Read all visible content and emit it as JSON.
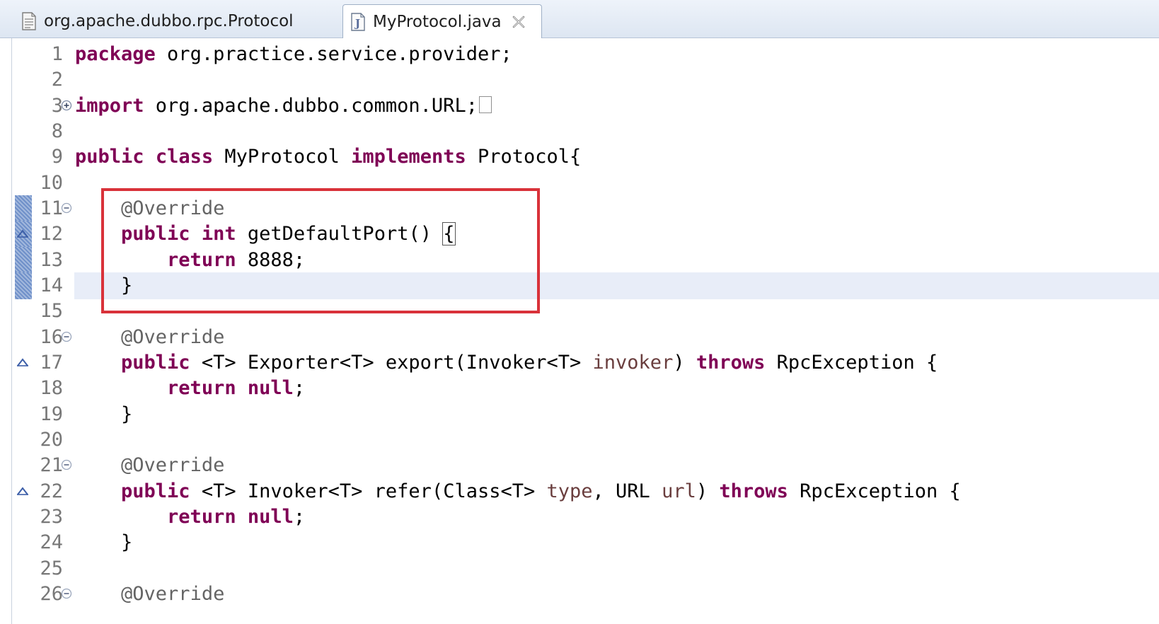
{
  "tabs": [
    {
      "label": "org.apache.dubbo.rpc.Protocol",
      "active": false
    },
    {
      "label": "MyProtocol.java",
      "active": true,
      "close_glyph": "✕"
    }
  ],
  "editor": {
    "lines": [
      {
        "num": "1",
        "tokens": [
          [
            "kw",
            "package"
          ],
          [
            "t",
            " org.practice.service.provider;"
          ]
        ]
      },
      {
        "num": "2",
        "tokens": []
      },
      {
        "num": "3",
        "fold": "expand",
        "tokens": [
          [
            "kw",
            "import"
          ],
          [
            "t",
            " org.apache.dubbo.common.URL;"
          ]
        ],
        "collapsed": true
      },
      {
        "num": "8",
        "tokens": []
      },
      {
        "num": "9",
        "tokens": [
          [
            "kw",
            "public"
          ],
          [
            "t",
            " "
          ],
          [
            "kw",
            "class"
          ],
          [
            "t",
            " MyProtocol "
          ],
          [
            "kw",
            "implements"
          ],
          [
            "t",
            " Protocol{"
          ]
        ]
      },
      {
        "num": "10",
        "tokens": []
      },
      {
        "num": "11",
        "fold": "collapse",
        "changed": true,
        "tokens": [
          [
            "t",
            "    "
          ],
          [
            "ann",
            "@Override"
          ]
        ]
      },
      {
        "num": "12",
        "changed": true,
        "override": true,
        "tokens": [
          [
            "t",
            "    "
          ],
          [
            "kw",
            "public"
          ],
          [
            "t",
            " "
          ],
          [
            "kw",
            "int"
          ],
          [
            "t",
            " getDefaultPort() "
          ],
          [
            "br",
            "{"
          ]
        ]
      },
      {
        "num": "13",
        "changed": true,
        "tokens": [
          [
            "t",
            "        "
          ],
          [
            "kw",
            "return"
          ],
          [
            "t",
            " 8888;"
          ]
        ]
      },
      {
        "num": "14",
        "changed": true,
        "current": true,
        "tokens": [
          [
            "t",
            "    }"
          ]
        ]
      },
      {
        "num": "15",
        "tokens": []
      },
      {
        "num": "16",
        "fold": "collapse",
        "tokens": [
          [
            "t",
            "    "
          ],
          [
            "ann",
            "@Override"
          ]
        ]
      },
      {
        "num": "17",
        "override": true,
        "tokens": [
          [
            "t",
            "    "
          ],
          [
            "kw",
            "public"
          ],
          [
            "t",
            " <T> Exporter<T> export(Invoker<T> "
          ],
          [
            "prm",
            "invoker"
          ],
          [
            "t",
            ") "
          ],
          [
            "kw",
            "throws"
          ],
          [
            "t",
            " RpcException {"
          ]
        ]
      },
      {
        "num": "18",
        "tokens": [
          [
            "t",
            "        "
          ],
          [
            "kw",
            "return"
          ],
          [
            "t",
            " "
          ],
          [
            "kw",
            "null"
          ],
          [
            "t",
            ";"
          ]
        ]
      },
      {
        "num": "19",
        "tokens": [
          [
            "t",
            "    }"
          ]
        ]
      },
      {
        "num": "20",
        "tokens": []
      },
      {
        "num": "21",
        "fold": "collapse",
        "tokens": [
          [
            "t",
            "    "
          ],
          [
            "ann",
            "@Override"
          ]
        ]
      },
      {
        "num": "22",
        "override": true,
        "tokens": [
          [
            "t",
            "    "
          ],
          [
            "kw",
            "public"
          ],
          [
            "t",
            " <T> Invoker<T> refer(Class<T> "
          ],
          [
            "prm",
            "type"
          ],
          [
            "t",
            ", URL "
          ],
          [
            "prm",
            "url"
          ],
          [
            "t",
            ") "
          ],
          [
            "kw",
            "throws"
          ],
          [
            "t",
            " RpcException {"
          ]
        ]
      },
      {
        "num": "23",
        "tokens": [
          [
            "t",
            "        "
          ],
          [
            "kw",
            "return"
          ],
          [
            "t",
            " "
          ],
          [
            "kw",
            "null"
          ],
          [
            "t",
            ";"
          ]
        ]
      },
      {
        "num": "24",
        "tokens": [
          [
            "t",
            "    }"
          ]
        ]
      },
      {
        "num": "25",
        "tokens": []
      },
      {
        "num": "26",
        "fold": "collapse",
        "tokens": [
          [
            "t",
            "    "
          ],
          [
            "ann",
            "@Override"
          ]
        ]
      }
    ]
  },
  "colors": {
    "keyword": "#7f0055",
    "annotation": "#646464",
    "parameter": "#6a3e3e",
    "highlight_box": "#d9323a",
    "current_line": "#e8edf8"
  },
  "icons": {
    "tab1": "class-file-icon",
    "tab2": "java-file-icon",
    "close": "close-tab-icon",
    "fold_expand": "fold-expand-icon",
    "fold_collapse": "fold-collapse-icon",
    "override": "override-marker-icon"
  }
}
